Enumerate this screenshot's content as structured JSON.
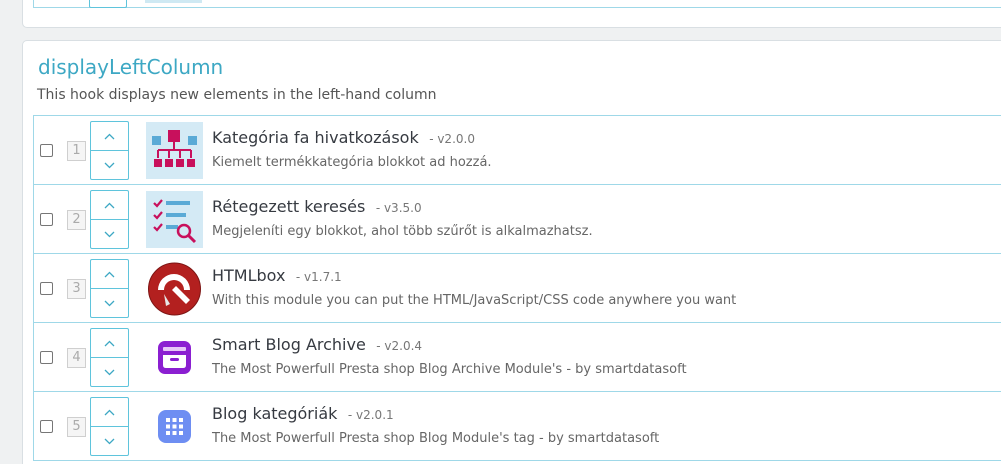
{
  "hook": {
    "title": "displayLeftColumn",
    "description": "This hook displays new elements in the left-hand column"
  },
  "modules": [
    {
      "position": "1",
      "name": "Kategória fa hivatkozások",
      "version": "- v2.0.0",
      "description": "Kiemelt termékkategória blokkot ad hozzá.",
      "icon": "category-tree-icon"
    },
    {
      "position": "2",
      "name": "Rétegezett keresés",
      "version": "- v3.5.0",
      "description": "Megjeleníti egy blokkot, ahol több szűrőt is alkalmazhatsz.",
      "icon": "layered-search-icon"
    },
    {
      "position": "3",
      "name": "HTMLbox",
      "version": "- v1.7.1",
      "description": "With this module you can put the HTML/JavaScript/CSS code anywhere you want",
      "icon": "htmlbox-icon"
    },
    {
      "position": "4",
      "name": "Smart Blog Archive",
      "version": "- v2.0.4",
      "description": "The Most Powerfull Presta shop Blog Archive Module's - by smartdatasoft",
      "icon": "archive-box-icon"
    },
    {
      "position": "5",
      "name": "Blog kategóriák",
      "version": "- v2.0.1",
      "description": "The Most Powerfull Presta shop Blog Module's tag - by smartdatasoft",
      "icon": "grid-app-icon"
    }
  ],
  "colors": {
    "accent": "#3da8c4",
    "row_border": "#9fd8e8",
    "magenta": "#c8105c",
    "purple": "#8b1fd1",
    "blue_light": "#6e8ef2"
  }
}
